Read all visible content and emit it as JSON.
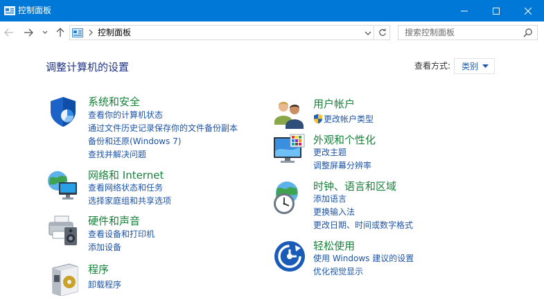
{
  "window": {
    "title": "控制面板"
  },
  "address": {
    "breadcrumb": "控制面板"
  },
  "search": {
    "placeholder": "搜索控制面板"
  },
  "main": {
    "heading": "调整计算机的设置",
    "view_label": "查看方式:",
    "view_value": "类别"
  },
  "categories": [
    {
      "title": "系统和安全",
      "icon": "system-security-icon",
      "links": [
        "查看你的计算机状态",
        "通过文件历史记录保存你的文件备份副本",
        "备份和还原(Windows 7)",
        "查找并解决问题"
      ]
    },
    {
      "title": "网络和 Internet",
      "icon": "network-icon",
      "links": [
        "查看网络状态和任务",
        "选择家庭组和共享选项"
      ]
    },
    {
      "title": "硬件和声音",
      "icon": "hardware-sound-icon",
      "links": [
        "查看设备和打印机",
        "添加设备"
      ]
    },
    {
      "title": "程序",
      "icon": "programs-icon",
      "links": [
        "卸载程序"
      ]
    },
    {
      "title": "用户帐户",
      "icon": "user-accounts-icon",
      "links": [
        "更改帐户类型"
      ]
    },
    {
      "title": "外观和个性化",
      "icon": "appearance-icon",
      "links": [
        "更改主题",
        "调整屏幕分辨率"
      ]
    },
    {
      "title": "时钟、语言和区域",
      "icon": "clock-region-icon",
      "links": [
        "添加语言",
        "更换输入法",
        "更改日期、时间或数字格式"
      ]
    },
    {
      "title": "轻松使用",
      "icon": "ease-of-access-icon",
      "links": [
        "使用 Windows 建议的设置",
        "优化视觉显示"
      ]
    }
  ],
  "colors": {
    "titlebar": "#0078d7",
    "heading": "#1e3287",
    "category_title": "#16823a",
    "link": "#1d54a7"
  }
}
